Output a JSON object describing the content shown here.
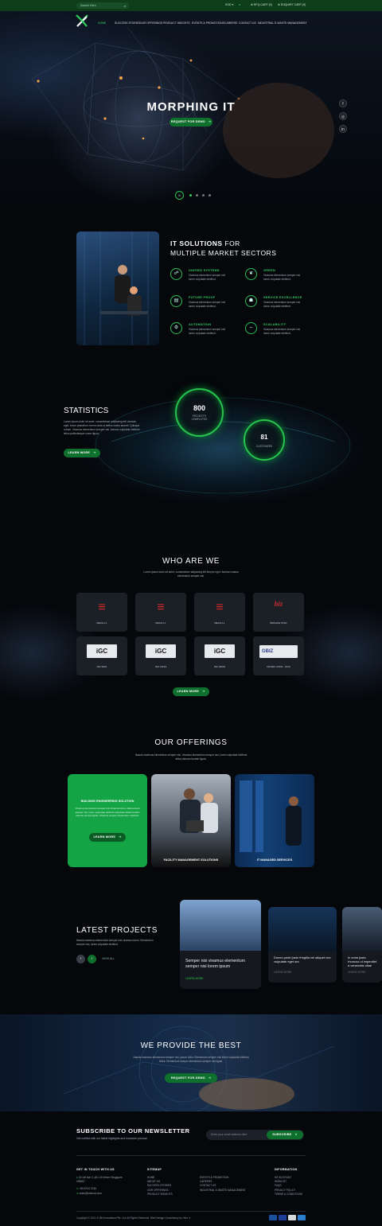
{
  "topbar": {
    "search_placeholder": "Search Here",
    "currency": "SGD",
    "rfq": "RFQ CART (0)",
    "enquiry": "ENQUIRY CART (0)"
  },
  "nav": {
    "items": [
      "HOME",
      "SUCCESS STORIES",
      "OUR OFFERINGS",
      "PRODUCT INSIGHTS",
      "EVENTS & PROMOTIONS",
      "CAREERS",
      "CONTACT US",
      "INDUSTRIAL E-WASTE MANAGEMENT"
    ]
  },
  "hero": {
    "title": "MORPHING IT",
    "cta": "REQUEST FOR DEMO"
  },
  "solutions": {
    "title_bold": "IT SOLUTIONS",
    "title_light": "FOR",
    "title_line2": "MULTIPLE MARKET SECTORS",
    "features": [
      {
        "title": "UNIFIED SYSTEMS",
        "text": "Vivamus elementum semper nisi lorem vulputate eleifend.",
        "icon": "network-icon"
      },
      {
        "title": "GREEN",
        "text": "Vivamus elementum semper nisi lorem vulputate eleifend.",
        "icon": "leaf-icon"
      },
      {
        "title": "FUTURE PROOF",
        "text": "Vivamus elementum semper nisi lorem vulputate eleifend.",
        "icon": "chart-icon"
      },
      {
        "title": "SERVICE EXCELLENCE",
        "text": "Vivamus elementum semper nisi lorem vulputate eleifend.",
        "icon": "service-icon"
      },
      {
        "title": "AUTOMATION",
        "text": "Vivamus elementum semper nisi lorem vulputate eleifend.",
        "icon": "gear-icon"
      },
      {
        "title": "SCALABILITY",
        "text": "Vivamus elementum semper nisi lorem vulputate eleifend.",
        "icon": "scale-icon"
      }
    ]
  },
  "statistics": {
    "title": "STATISTICS",
    "text": "Lorem ipsum dolor sit amet, consectetuer adipiscing elit. Aenean eget, lorem phasellus viverra nulla ut metus varius laoreet. Quisque rutrum. Vivamus elementum semper nisi. Aenean vulputate eleifend tellus pellentesque lorem ligula.",
    "cta": "LEARN MORE",
    "stat1_value": "800",
    "stat1_label": "PROJECTS COMPLETED",
    "stat2_value": "81",
    "stat2_label": "CUSTOMERS"
  },
  "who": {
    "title": "WHO ARE WE",
    "text": "Lorem ipsum dolor sit amet, consectetuer adipiscing elit tempor eget. Aenean massa elementum semper nisi.",
    "certs": [
      "MECH-L1",
      "MECH-L1",
      "MECH-L1",
      "BIZSAFE STAR",
      "ISO 9001",
      "ISO 14001",
      "ISO 45001",
      "ISO/IEC 27001 : 2013"
    ],
    "cta": "LEARN MORE"
  },
  "offerings": {
    "title": "OUR OFFERINGS",
    "text": "Nascia maximus elementum semper nisi. Vivamus elementum semper nisi, lorem vulputate eleifend tellus aenean laoreet ligula.",
    "card1_title": "BUILDING ENGINEERING SOLUTION",
    "card1_text": "Vivamus elementum semper nisi Vivamus lorem. Elementum semper nisi, lorem vulputate eleifend vulputate eleifend tellus aenean laoreet ligula. Vivamus semper elementum eleifend.",
    "card1_cta": "LEARN MORE",
    "card2_title": "FACILITY MANAGEMENT SOLUTIONS",
    "card3_title": "IT MANAGED SERVICES"
  },
  "projects": {
    "title": "LATEST PROJECTS",
    "text": "Nascia maximus elementum semper nisi vivamus lorem. Elementum semper nisi, lorem vulputate eleifend.",
    "view_all": "VIEW ALL",
    "items": [
      {
        "title": "Semper nisi vivamus elementum semper nisi lorem ipsum",
        "cta": "LEARN MORE"
      },
      {
        "title": "Donec pede justo fringilla vel aliquet nec vulputate eget arc",
        "cta": "LEARN MORE"
      },
      {
        "title": "In enim justo rhoncus ut imperdiet a venenatis vitae",
        "cta": "LEARN MORE"
      }
    ]
  },
  "provide": {
    "title": "WE PROVIDE THE BEST",
    "text": "Nascia maximus elementum semper nisi, ipsum dolor. Elementum semper nisi lorem vulputate eleifend tellus. Elementum semper elementum semper nisi ligula.",
    "cta": "REQUEST FOR DEMO"
  },
  "newsletter": {
    "title": "SUBSCRIBE TO OUR NEWSLETTER",
    "text": "Get notified with our latest highlights and exclusive promos!",
    "placeholder": "Enter your email address here",
    "button": "SUBSCRIBE"
  },
  "footer": {
    "contact_title": "GET IN TOUCH WITH US",
    "address": "32 Ubi Ave 3, #01-18 Vertex Singapore 408867",
    "phone": "+65 6744 3746",
    "email": "sales@kformat.com",
    "sitemap_title": "SITEMAP",
    "sitemap_col1": [
      "HOME",
      "ABOUT US",
      "SUCCESS STORIES",
      "OUR OFFERINGS",
      "PRODUCT INSIGHTS"
    ],
    "sitemap_col2": [
      "EVENTS & PROMOTION",
      "CAREERS",
      "CONTACT US",
      "INDUSTRIAL E-WASTE MANAGEMENT"
    ],
    "info_title": "INFORMATION",
    "info_links": [
      "MY ACCOUNT",
      "WISHLIST",
      "FAQS",
      "PRIVACY POLICY",
      "TERMS & CONDITIONS"
    ],
    "copyright": "Copyright © 2021 K-IM Innovations Pte. Ltd. All Rights Reserved. Web Design Consultancy by Verz"
  },
  "colors": {
    "accent": "#27c34f",
    "button": "#0f6f2c",
    "topbar": "#0e3d1a"
  }
}
